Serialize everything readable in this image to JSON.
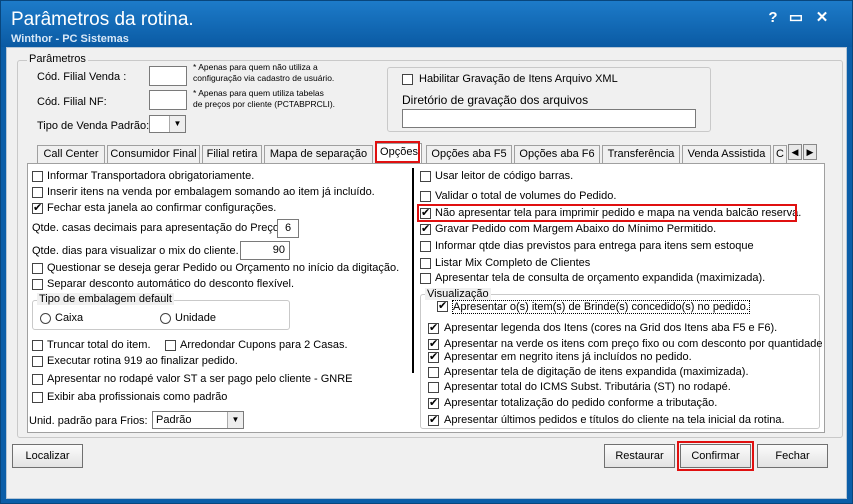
{
  "window": {
    "title": "Parâmetros da rotina.",
    "subtitle": "Winthor - PC Sistemas",
    "help_glyph": "?",
    "restore_glyph": "▭",
    "close_glyph": "✕"
  },
  "params": {
    "group_label": "Parâmetros",
    "filial_venda_label": "Cód. Filial Venda :",
    "filial_venda_value": "",
    "filial_venda_note_1": "* Apenas para quem não utiliza a",
    "filial_venda_note_2": "configuração via cadastro de usuário.",
    "filial_nf_label": "Cód. Filial NF:",
    "filial_nf_value": "",
    "filial_nf_note_1": "* Apenas para quem utiliza tabelas",
    "filial_nf_note_2": "de preços por cliente (PCTABPRCLI).",
    "tipo_venda_label": "Tipo de Venda Padrão:",
    "tipo_venda_value": "",
    "xml_label": "Habilitar Gravação de Itens Arquivo XML",
    "xml_checked": false,
    "dir_label": "Diretório de gravação dos arquivos",
    "dir_value": ""
  },
  "tabs": [
    {
      "label": "Call Center"
    },
    {
      "label": "Consumidor Final"
    },
    {
      "label": "Filial retira"
    },
    {
      "label": "Mapa de separação"
    },
    {
      "label": "Opções"
    },
    {
      "label": "Opções aba F5"
    },
    {
      "label": "Opções aba F6"
    },
    {
      "label": "Transferência"
    },
    {
      "label": "Venda Assistida"
    },
    {
      "label": "C"
    }
  ],
  "tab_arrows": {
    "left": "◀",
    "right": "▶"
  },
  "left": {
    "transportadora": "Informar Transportadora obrigatoriamente.",
    "embalagem": "Inserir itens na venda por embalagem somando ao item já incluído.",
    "fechar": "Fechar esta janela ao confirmar configurações.",
    "casas_label": "Qtde. casas decimais para apresentação do Preço.",
    "casas_value": "6",
    "dias_label": "Qtde. dias para visualizar o mix do cliente.",
    "dias_value": "90",
    "questionar": "Questionar se deseja gerar Pedido ou Orçamento no início da digitação.",
    "separar": "Separar desconto automático do desconto flexível.",
    "tipo_emb_label": "Tipo de embalagem default",
    "caixa": "Caixa",
    "unidade": "Unidade",
    "truncar": "Truncar total do item.",
    "arredondar": "Arredondar Cupons para 2 Casas.",
    "rotina919": "Executar rotina 919 ao finalizar pedido.",
    "rodape_st": "Apresentar no rodapé valor ST a ser pago pelo cliente - GNRE",
    "exibir_aba": "Exibir aba profissionais como padrão",
    "frios_label": "Unid. padrão para Frios:",
    "frios_value": "Padrão"
  },
  "right": {
    "leitor": "Usar leitor de código barras.",
    "validar": "Validar o total de volumes do Pedido.",
    "nao_apresentar": "Não apresentar tela para imprimir pedido e mapa na venda balcão reserva.",
    "gravar_margem": "Gravar Pedido com Margem Abaixo do Mínimo Permitido.",
    "informar_dias": "Informar qtde dias previstos para entrega para itens sem estoque",
    "listar_mix": "Listar Mix Completo de Clientes",
    "consulta_orc": "Apresentar tela de consulta de orçamento expandida (maximizada).",
    "visualizacao_label": "Visualização",
    "brinde": "Apresentar o(s) item(s) de Brinde(s) concedido(s) no pedido.",
    "legenda": "Apresentar legenda dos Itens (cores na Grid dos Itens aba F5 e F6).",
    "verde": "Apresentar na verde os itens com preço fixo ou com desconto por quantidade",
    "negrito": "Apresentar em negrito itens já incluídos no pedido.",
    "digitacao": "Apresentar tela de digitação de itens expandida (maximizada).",
    "icms": "Apresentar total do ICMS Subst. Tributária (ST) no rodapé.",
    "totalizacao": "Apresentar totalização do pedido conforme a tributação.",
    "ultimos": "Apresentar últimos pedidos e títulos do cliente na tela inicial da rotina."
  },
  "buttons": {
    "localizar": "Localizar",
    "restaurar": "Restaurar",
    "confirmar": "Confirmar",
    "fechar": "Fechar"
  }
}
